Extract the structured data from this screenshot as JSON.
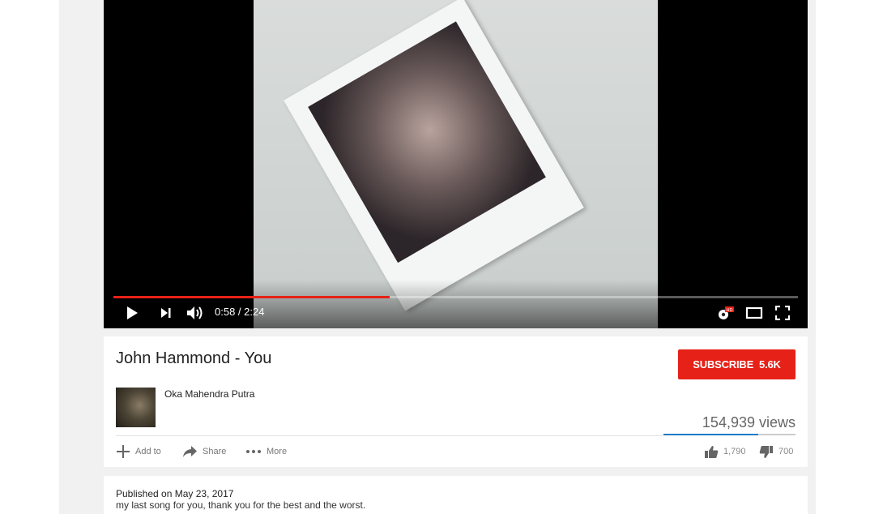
{
  "player": {
    "current_time": "0:58",
    "duration": "2:24",
    "time_separator": " / ",
    "progress_fraction": 0.403,
    "accent_color": "#e62117",
    "hd_badge": "HD",
    "icons": [
      "play-icon",
      "next-icon",
      "volume-icon",
      "settings-icon",
      "theater-mode-icon",
      "fullscreen-icon"
    ]
  },
  "video": {
    "title": "John Hammond - You",
    "views": "154,939 views"
  },
  "channel": {
    "name": "Oka Mahendra Putra",
    "subscribe_label": "SUBSCRIBE",
    "subscriber_count": "5.6K"
  },
  "actions": {
    "add_to_label": "Add to",
    "share_label": "Share",
    "more_label": "More",
    "likes": "1,790",
    "dislikes": "700",
    "like_fraction": 0.72,
    "like_color": "#167ac6"
  },
  "description": {
    "published": "Published on May 23, 2017",
    "text": "my last song for you, thank you for the best and the worst."
  }
}
